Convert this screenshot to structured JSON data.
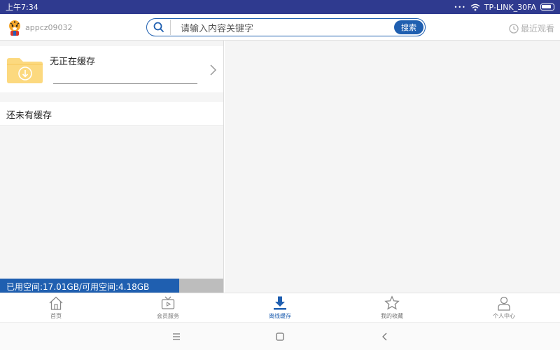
{
  "status_bar": {
    "time": "上午7:34",
    "network": "TP-LINK_30FA"
  },
  "header": {
    "username": "appcz09032",
    "search": {
      "placeholder": "请输入内容关键字",
      "button_label": "搜索"
    },
    "recent_label": "最近观看"
  },
  "cache": {
    "downloading_label": "无正在缓存",
    "progress": 0,
    "empty_label": "还未有缓存"
  },
  "storage": {
    "text": "已用空间:17.01GB/可用空间:4.18GB",
    "used_gb": 17.01,
    "available_gb": 4.18
  },
  "bottom_nav": {
    "items": [
      {
        "label": "首页",
        "icon": "home-icon"
      },
      {
        "label": "会员服务",
        "icon": "tv-icon"
      },
      {
        "label": "离线缓存",
        "icon": "download-icon",
        "active": true
      },
      {
        "label": "我的收藏",
        "icon": "star-icon"
      },
      {
        "label": "个人中心",
        "icon": "person-icon"
      }
    ]
  },
  "colors": {
    "accent": "#1f5fb0",
    "status_bar": "#2f3a8f",
    "folder": "#fcd97f"
  }
}
